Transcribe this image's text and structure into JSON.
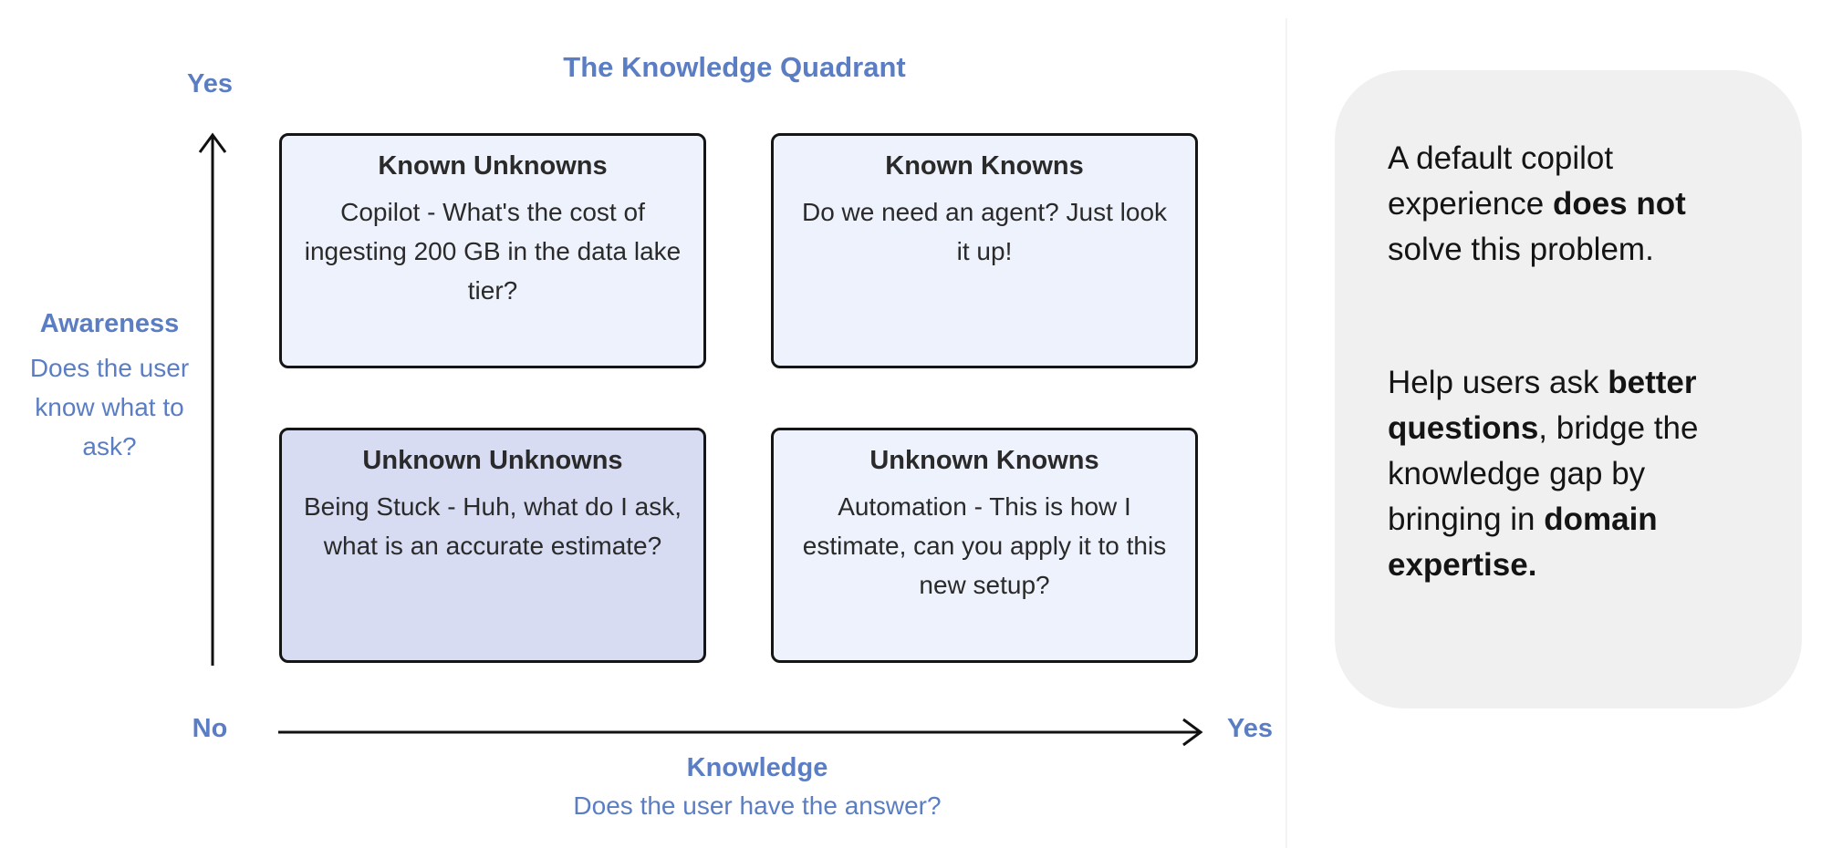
{
  "title": "The Knowledge Quadrant",
  "axes": {
    "y_top_label": "Yes",
    "origin_label": "No",
    "x_right_label": "Yes",
    "y_title": "Awareness",
    "y_subtitle": "Does the user know what to ask?",
    "x_title": "Knowledge",
    "x_subtitle": "Does the user have the answer?"
  },
  "quadrants": [
    {
      "heading": "Known Unknowns",
      "body": "Copilot - What's the cost of ingesting 200 GB in the data lake tier?"
    },
    {
      "heading": "Known Knowns",
      "body": "Do we need an agent? Just look it up!"
    },
    {
      "heading": "Unknown Unknowns",
      "body": "Being Stuck - Huh, what do I ask, what is an accurate estimate?"
    },
    {
      "heading": "Unknown Knowns",
      "body": "Automation - This is how I estimate, can you apply it to this new setup?"
    }
  ],
  "side_panel": {
    "p1_a": "A default copilot experience ",
    "p1_b": "does not",
    "p1_c": " solve this problem.",
    "p2_a": "Help users ask ",
    "p2_b": "better questions",
    "p2_c": ", bridge the knowledge gap by bringing in ",
    "p2_d": "domain expertise."
  },
  "colors": {
    "accent": "#5a7dc4",
    "quadrant_fill": "#eef2fc",
    "quadrant_highlight_fill": "#d7dcf3",
    "panel_bg": "#f0f0f0"
  }
}
